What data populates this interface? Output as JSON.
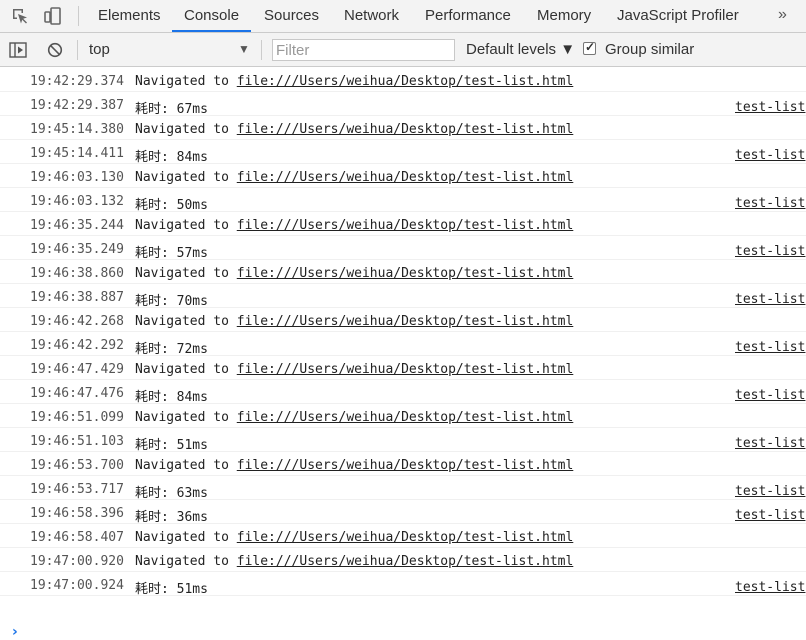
{
  "tabs": [
    {
      "label": "Elements"
    },
    {
      "label": "Console",
      "active": true
    },
    {
      "label": "Sources"
    },
    {
      "label": "Network"
    },
    {
      "label": "Performance"
    },
    {
      "label": "Memory"
    },
    {
      "label": "JavaScript Profiler"
    }
  ],
  "more_label": "»",
  "toolbar": {
    "context": "top",
    "context_arrow": "▼",
    "filter_placeholder": "Filter",
    "levels_label": "Default levels ▼",
    "group_similar_label": "Group similar",
    "group_similar_checked": true
  },
  "log": [
    {
      "time": "19:42:29.374",
      "text": "Navigated to ",
      "link": "file:///Users/weihua/Desktop/test-list.html"
    },
    {
      "time": "19:42:29.387",
      "text": "耗时: 67ms",
      "source": "test-list"
    },
    {
      "time": "19:45:14.380",
      "text": "Navigated to ",
      "link": "file:///Users/weihua/Desktop/test-list.html"
    },
    {
      "time": "19:45:14.411",
      "text": "耗时: 84ms",
      "source": "test-list"
    },
    {
      "time": "19:46:03.130",
      "text": "Navigated to ",
      "link": "file:///Users/weihua/Desktop/test-list.html"
    },
    {
      "time": "19:46:03.132",
      "text": "耗时: 50ms",
      "source": "test-list"
    },
    {
      "time": "19:46:35.244",
      "text": "Navigated to ",
      "link": "file:///Users/weihua/Desktop/test-list.html"
    },
    {
      "time": "19:46:35.249",
      "text": "耗时: 57ms",
      "source": "test-list"
    },
    {
      "time": "19:46:38.860",
      "text": "Navigated to ",
      "link": "file:///Users/weihua/Desktop/test-list.html"
    },
    {
      "time": "19:46:38.887",
      "text": "耗时: 70ms",
      "source": "test-list"
    },
    {
      "time": "19:46:42.268",
      "text": "Navigated to ",
      "link": "file:///Users/weihua/Desktop/test-list.html"
    },
    {
      "time": "19:46:42.292",
      "text": "耗时: 72ms",
      "source": "test-list"
    },
    {
      "time": "19:46:47.429",
      "text": "Navigated to ",
      "link": "file:///Users/weihua/Desktop/test-list.html"
    },
    {
      "time": "19:46:47.476",
      "text": "耗时: 84ms",
      "source": "test-list"
    },
    {
      "time": "19:46:51.099",
      "text": "Navigated to ",
      "link": "file:///Users/weihua/Desktop/test-list.html"
    },
    {
      "time": "19:46:51.103",
      "text": "耗时: 51ms",
      "source": "test-list"
    },
    {
      "time": "19:46:53.700",
      "text": "Navigated to ",
      "link": "file:///Users/weihua/Desktop/test-list.html"
    },
    {
      "time": "19:46:53.717",
      "text": "耗时: 63ms",
      "source": "test-list"
    },
    {
      "time": "19:46:58.396",
      "text": "耗时: 36ms",
      "source": "test-list"
    },
    {
      "time": "19:46:58.407",
      "text": "Navigated to ",
      "link": "file:///Users/weihua/Desktop/test-list.html"
    },
    {
      "time": "19:47:00.920",
      "text": "Navigated to ",
      "link": "file:///Users/weihua/Desktop/test-list.html"
    },
    {
      "time": "19:47:00.924",
      "text": "耗时: 51ms",
      "source": "test-list"
    }
  ],
  "prompt_symbol": "›",
  "accent_color": "#1a73e8"
}
